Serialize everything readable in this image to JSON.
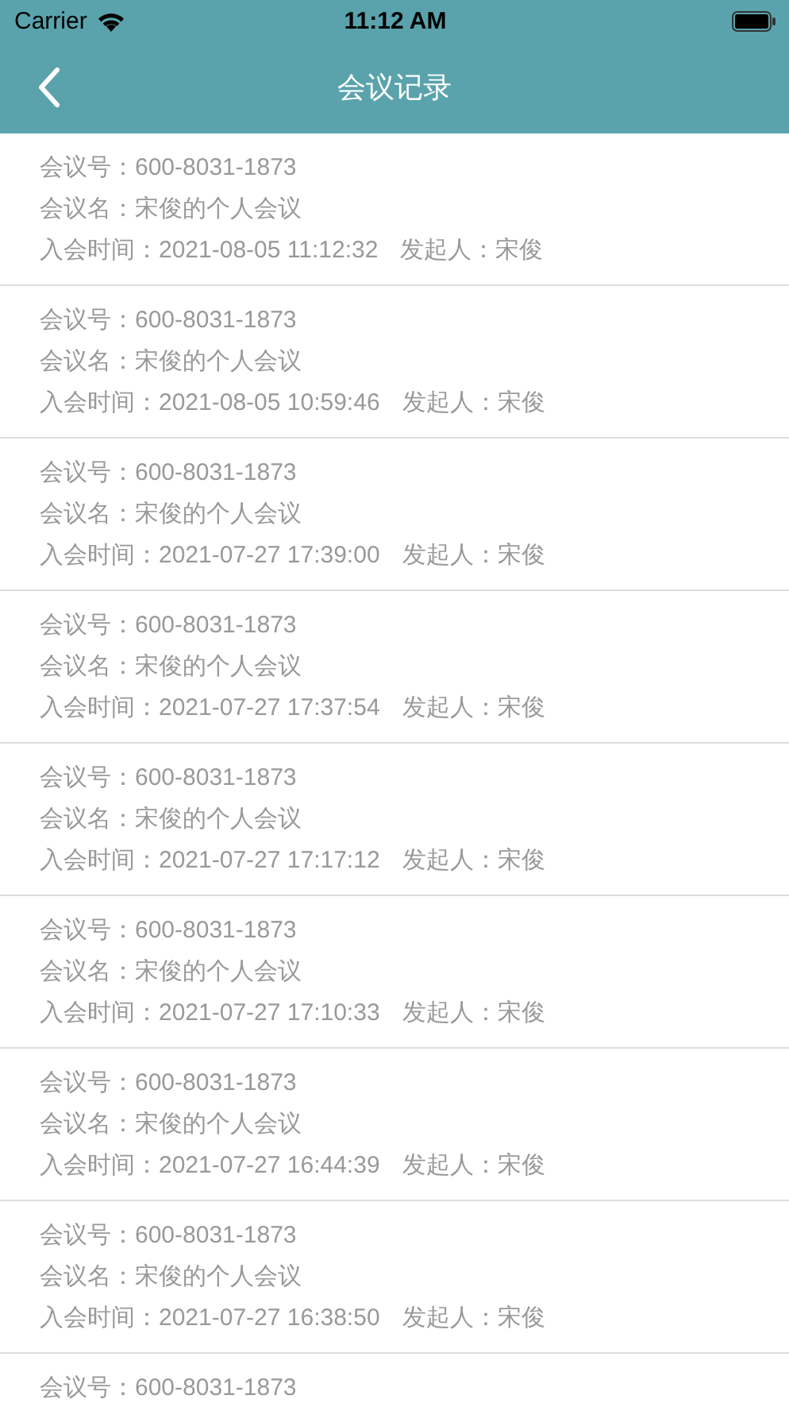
{
  "status_bar": {
    "carrier": "Carrier",
    "time": "11:12 AM"
  },
  "nav": {
    "title": "会议记录"
  },
  "records": [
    {
      "number": "会议号：600-8031-1873",
      "name": "会议名：宋俊的个人会议",
      "time": "入会时间：2021-08-05 11:12:32",
      "initiator": "发起人：宋俊"
    },
    {
      "number": "会议号：600-8031-1873",
      "name": "会议名：宋俊的个人会议",
      "time": "入会时间：2021-08-05 10:59:46",
      "initiator": "发起人：宋俊"
    },
    {
      "number": "会议号：600-8031-1873",
      "name": "会议名：宋俊的个人会议",
      "time": "入会时间：2021-07-27 17:39:00",
      "initiator": "发起人：宋俊"
    },
    {
      "number": "会议号：600-8031-1873",
      "name": "会议名：宋俊的个人会议",
      "time": "入会时间：2021-07-27 17:37:54",
      "initiator": "发起人：宋俊"
    },
    {
      "number": "会议号：600-8031-1873",
      "name": "会议名：宋俊的个人会议",
      "time": "入会时间：2021-07-27 17:17:12",
      "initiator": "发起人：宋俊"
    },
    {
      "number": "会议号：600-8031-1873",
      "name": "会议名：宋俊的个人会议",
      "time": "入会时间：2021-07-27 17:10:33",
      "initiator": "发起人：宋俊"
    },
    {
      "number": "会议号：600-8031-1873",
      "name": "会议名：宋俊的个人会议",
      "time": "入会时间：2021-07-27 16:44:39",
      "initiator": "发起人：宋俊"
    },
    {
      "number": "会议号：600-8031-1873",
      "name": "会议名：宋俊的个人会议",
      "time": "入会时间：2021-07-27 16:38:50",
      "initiator": "发起人：宋俊"
    },
    {
      "number": "会议号：600-8031-1873"
    }
  ]
}
